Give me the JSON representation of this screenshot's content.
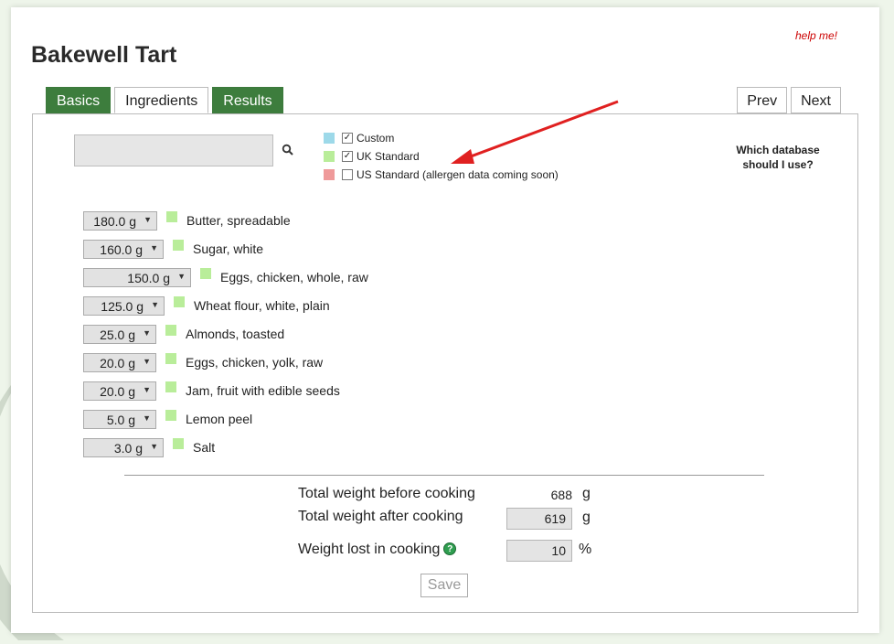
{
  "page": {
    "title": "Bakewell Tart",
    "help_link": "help me!"
  },
  "tabs": [
    {
      "label": "Basics",
      "active": false
    },
    {
      "label": "Ingredients",
      "active": true
    },
    {
      "label": "Results",
      "active": false
    }
  ],
  "nav": {
    "prev": "Prev",
    "next": "Next"
  },
  "search": {
    "value": "",
    "placeholder": "",
    "icon": "search-icon"
  },
  "databases": [
    {
      "label": "Custom",
      "checked": true,
      "color": "#9dd9e9"
    },
    {
      "label": "UK Standard",
      "checked": true,
      "color": "#b9ed9a"
    },
    {
      "label": "US Standard (allergen data coming soon)",
      "checked": false,
      "color": "#ef9a9a"
    }
  ],
  "which_db": "Which database should I use?",
  "ingredients": [
    {
      "amount": "180.0 g",
      "name": "Butter, spreadable"
    },
    {
      "amount": "160.0 g",
      "name": "Sugar, white"
    },
    {
      "amount": "150.0 g",
      "name": "Eggs, chicken, whole, raw"
    },
    {
      "amount": "125.0 g",
      "name": "Wheat flour, white, plain"
    },
    {
      "amount": "25.0 g",
      "name": "Almonds, toasted"
    },
    {
      "amount": "20.0 g",
      "name": "Eggs, chicken, yolk, raw"
    },
    {
      "amount": "20.0 g",
      "name": "Jam, fruit with edible seeds"
    },
    {
      "amount": "5.0 g",
      "name": "Lemon peel"
    },
    {
      "amount": "3.0 g",
      "name": "Salt"
    }
  ],
  "totals": {
    "before_label": "Total weight before cooking",
    "before_value": "688",
    "before_unit": "g",
    "after_label": "Total weight after cooking",
    "after_value": "619",
    "after_unit": "g",
    "lost_label": "Weight lost in cooking",
    "lost_value": "10",
    "lost_unit": "%",
    "info_icon": "?"
  },
  "save_label": "Save",
  "colors": {
    "tab_green": "#3d7d3d",
    "help_red": "#cc0000",
    "ingredient_swatch": "#b9ed9a",
    "arrow": "#e02020"
  }
}
